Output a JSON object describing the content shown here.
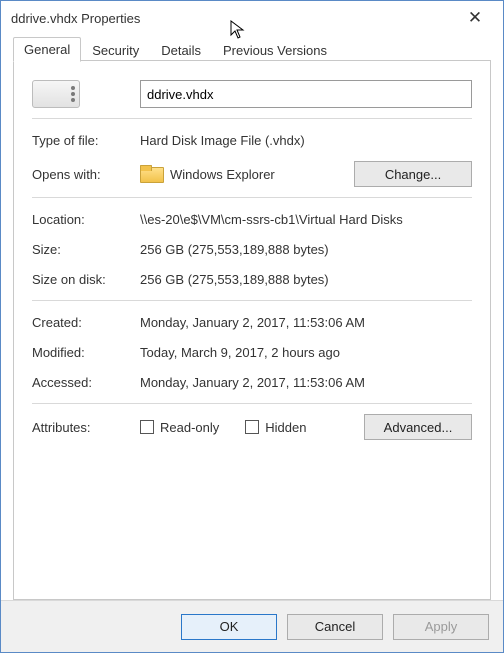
{
  "window": {
    "title": "ddrive.vhdx Properties",
    "close_glyph": "✕"
  },
  "tabs": {
    "general": "General",
    "security": "Security",
    "details": "Details",
    "previous": "Previous Versions"
  },
  "general": {
    "filename": "ddrive.vhdx",
    "type_label": "Type of file:",
    "type_value": "Hard Disk Image File (.vhdx)",
    "opens_label": "Opens with:",
    "opens_value": "Windows Explorer",
    "change_btn": "Change...",
    "location_label": "Location:",
    "location_value": "\\\\es-20\\e$\\VM\\cm-ssrs-cb1\\Virtual Hard Disks",
    "size_label": "Size:",
    "size_value": "256 GB (275,553,189,888 bytes)",
    "sizeondisk_label": "Size on disk:",
    "sizeondisk_value": "256 GB (275,553,189,888 bytes)",
    "created_label": "Created:",
    "created_value": "Monday, January 2, 2017, 11:53:06 AM",
    "modified_label": "Modified:",
    "modified_value": "Today, March 9, 2017, 2 hours ago",
    "accessed_label": "Accessed:",
    "accessed_value": "Monday, January 2, 2017, 11:53:06 AM",
    "attributes_label": "Attributes:",
    "readonly_label": "Read-only",
    "hidden_label": "Hidden",
    "advanced_btn": "Advanced..."
  },
  "footer": {
    "ok": "OK",
    "cancel": "Cancel",
    "apply": "Apply"
  }
}
